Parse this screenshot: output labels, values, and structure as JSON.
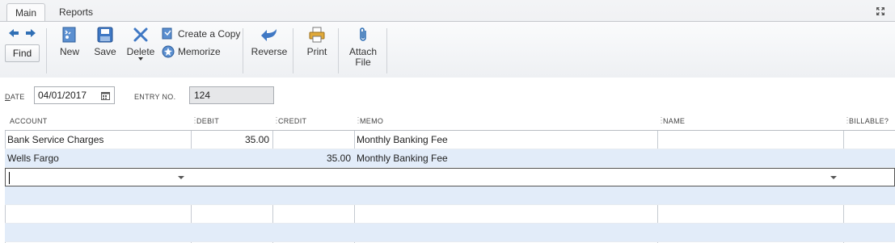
{
  "tabs": [
    {
      "label": "Main",
      "active": true
    },
    {
      "label": "Reports",
      "active": false
    }
  ],
  "toolbar": {
    "find": "Find",
    "new": "New",
    "save": "Save",
    "delete": "Delete",
    "create_copy": "Create a Copy",
    "memorize": "Memorize",
    "reverse": "Reverse",
    "print": "Print",
    "attach_file_line1": "Attach",
    "attach_file_line2": "File"
  },
  "header": {
    "date_label_first": "D",
    "date_label_rest": "ATE",
    "date_value": "04/01/2017",
    "entry_label": "ENTRY NO.",
    "entry_value": "124"
  },
  "grid": {
    "columns": [
      "ACCOUNT",
      "DEBIT",
      "CREDIT",
      "MEMO",
      "NAME",
      "BILLABLE?"
    ],
    "rows": [
      {
        "account": "Bank Service Charges",
        "debit": "35.00",
        "credit": "",
        "memo": "Monthly Banking Fee",
        "name": "",
        "billable": ""
      },
      {
        "account": "Wells Fargo",
        "debit": "",
        "credit": "35.00",
        "memo": "Monthly Banking Fee",
        "name": "",
        "billable": ""
      }
    ]
  },
  "colors": {
    "row_alt": "#e2ecf9",
    "accent_blue": "#2f6fb5"
  }
}
